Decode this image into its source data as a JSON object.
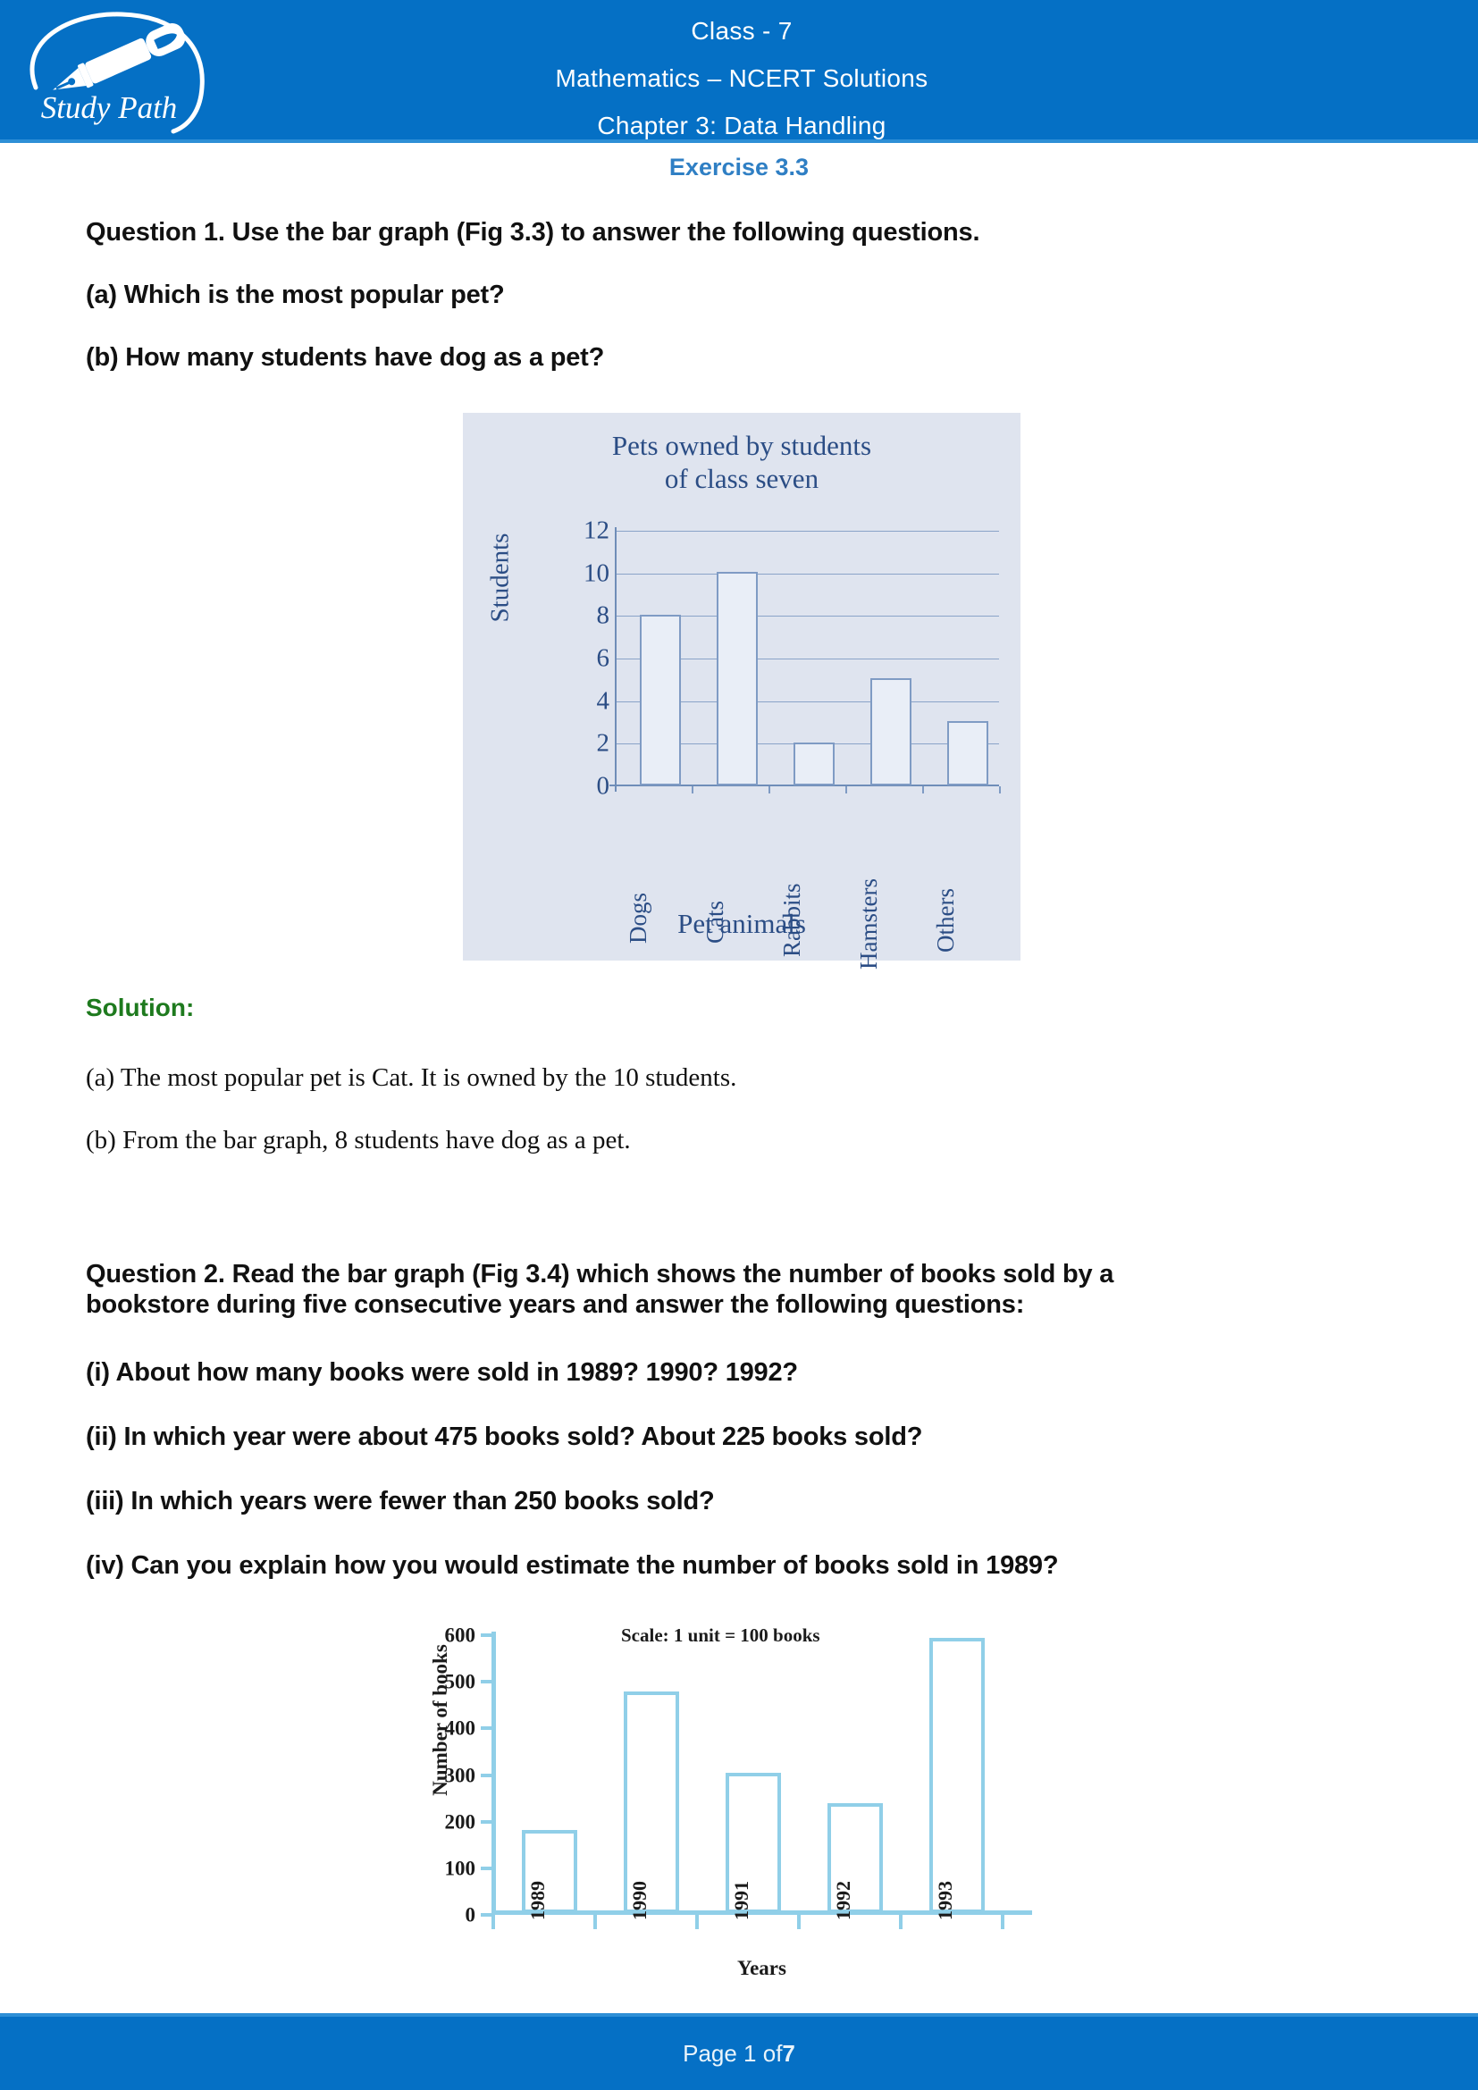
{
  "header": {
    "logo_text": "Study Path",
    "line1": "Class - 7",
    "line2": "Mathematics – NCERT Solutions",
    "line3": "Chapter 3: Data Handling"
  },
  "exercise_title": "Exercise 3.3",
  "question1": {
    "stem": "Question 1. Use the bar graph (Fig 3.3) to answer the following questions.",
    "part_a": "(a) Which is the most popular pet?",
    "part_b": "(b) How many students have dog as a pet?"
  },
  "solution1": {
    "heading": "Solution:",
    "part_a": "(a) The most popular pet is Cat. It is owned by the 10 students.",
    "part_b": "(b) From the bar graph, 8 students have dog as a pet."
  },
  "question2": {
    "stem_line1": "Question 2. Read the bar graph (Fig 3.4) which shows the number of books sold by a",
    "stem_line2": "bookstore during five consecutive years and answer the following questions:",
    "part_i": "(i) About how many books were sold in 1989? 1990? 1992?",
    "part_ii": "(ii) In which year were about 475 books sold? About 225 books sold?",
    "part_iii": "(iii) In which years were fewer than 250 books sold?",
    "part_iv": "(iv) Can you explain how you would estimate the number of books sold in 1989?"
  },
  "footer": {
    "prefix": "Page 1 of ",
    "total_pages": "7"
  },
  "colors": {
    "brand_blue": "#0570c5",
    "accent_blue": "#2e8fd6",
    "exercise_title": "#2f7fc4",
    "solution_green": "#1e7a1e",
    "chart1_panel": "#dfe4ef",
    "chart1_ink": "#2b4d85",
    "chart1_bar_fill": "#e9eef7",
    "chart1_bar_stroke": "#7f9bc4",
    "chart2_axis": "#90cfe8",
    "chart2_ink": "#1b1b1b"
  },
  "chart_data": [
    {
      "type": "bar",
      "id": "fig-3-3",
      "title": "Pets owned by students of class seven",
      "title_line1": "Pets owned by students",
      "title_line2": "of class seven",
      "xlabel": "Pet animals",
      "ylabel": "Students",
      "categories": [
        "Dogs",
        "Cats",
        "Rabbits",
        "Hamsters",
        "Others"
      ],
      "values": [
        8,
        10,
        2,
        5,
        3
      ],
      "ylim": [
        0,
        12
      ],
      "yticks": [
        0,
        2,
        4,
        6,
        8,
        10,
        12
      ],
      "grid": true,
      "legend": "none"
    },
    {
      "type": "bar",
      "id": "fig-3-4",
      "title": "Scale: 1 unit = 100 books",
      "xlabel": "Years",
      "ylabel": "Number of books",
      "categories": [
        "1989",
        "1990",
        "1991",
        "1992",
        "1993"
      ],
      "values": [
        175,
        475,
        300,
        235,
        590
      ],
      "ylim": [
        0,
        600
      ],
      "yticks": [
        0,
        100,
        200,
        300,
        400,
        500,
        600
      ],
      "grid": false,
      "legend": "none"
    }
  ]
}
